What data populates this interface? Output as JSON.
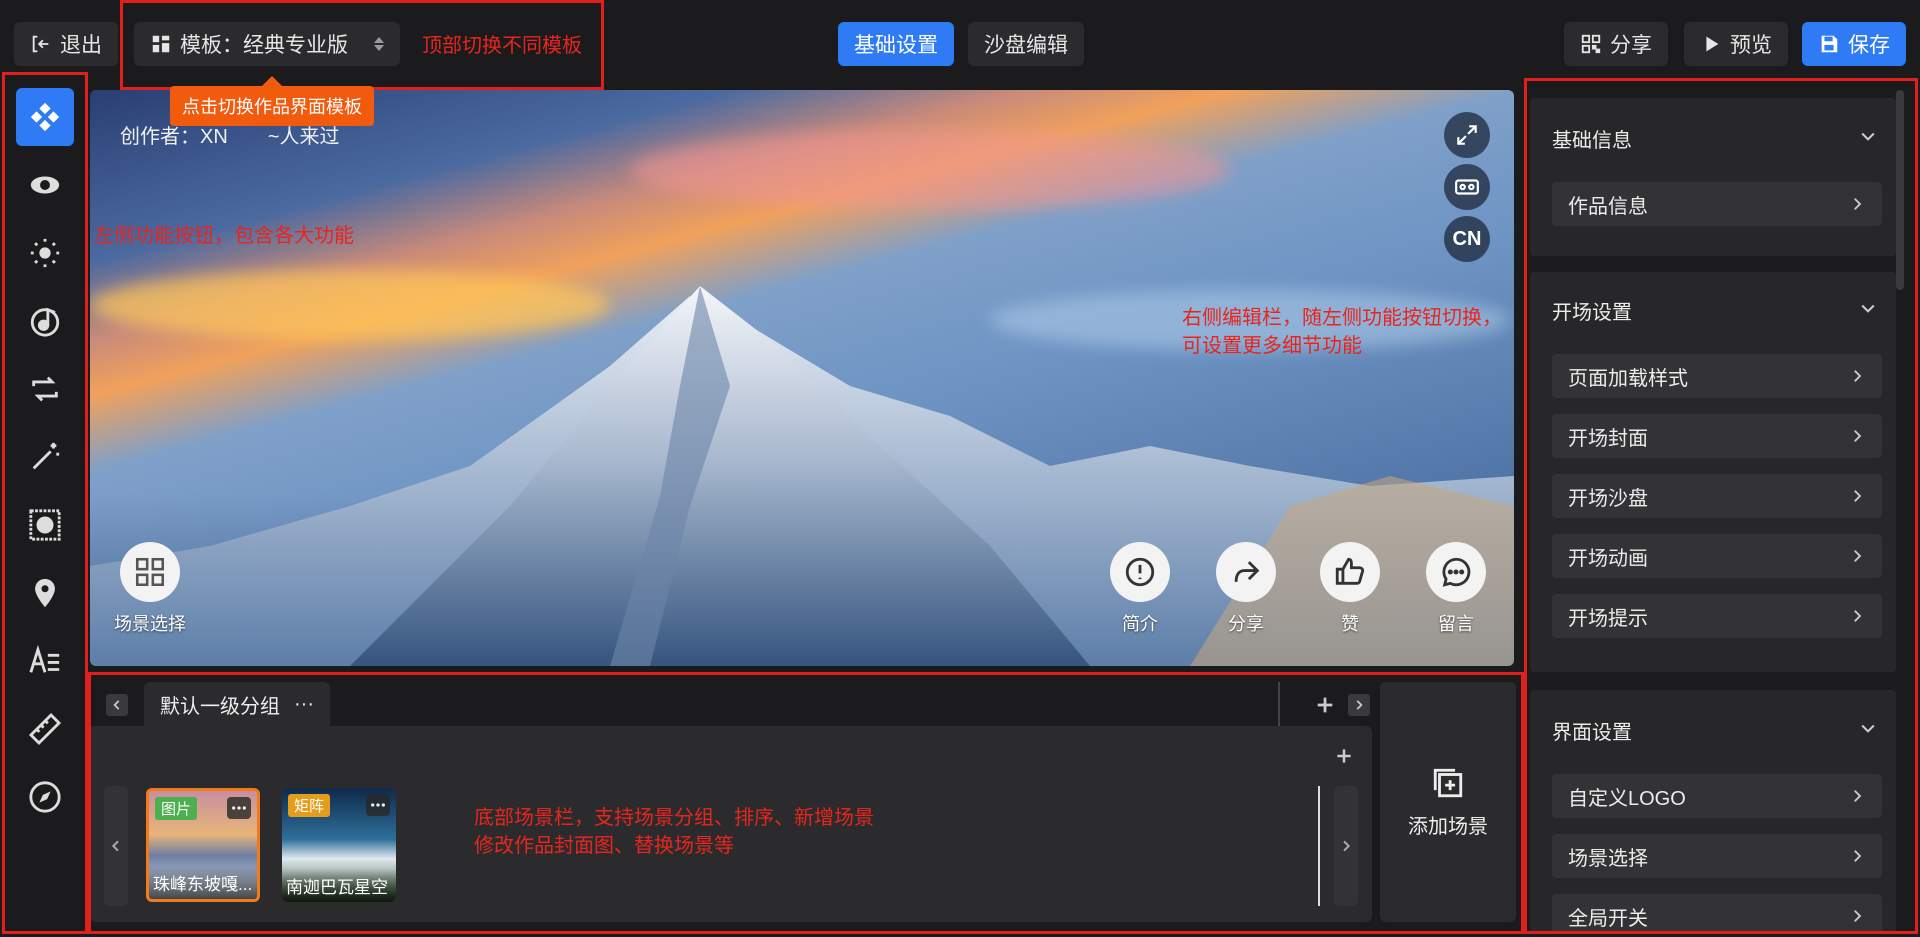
{
  "header": {
    "exit_label": "退出",
    "template_label": "模板：经典专业版",
    "tabs": [
      {
        "label": "基础设置",
        "active": true
      },
      {
        "label": "沙盘编辑",
        "active": false
      }
    ],
    "share_label": "分享",
    "preview_label": "预览",
    "save_label": "保存",
    "accent_color": "#2f7bf5"
  },
  "annotations": {
    "top": "顶部切换不同模板",
    "tooltip": "点击切换作品界面模板",
    "left": "左侧功能按钮，包含各大功能",
    "right_line1": "右侧编辑栏，随左侧功能按钮切换，",
    "right_line2": "可设置更多细节功能",
    "bottom_line1": "底部场景栏，支持场景分组、排序、新增场景",
    "bottom_line2": "修改作品封面图、替换场景等",
    "color": "#e0201c"
  },
  "sidebar": {
    "items": [
      {
        "icon": "layers-icon",
        "active": true
      },
      {
        "icon": "eye-icon"
      },
      {
        "icon": "sun-icon"
      },
      {
        "icon": "music-icon"
      },
      {
        "icon": "switch-icon"
      },
      {
        "icon": "magic-wand-icon"
      },
      {
        "icon": "image-frame-icon"
      },
      {
        "icon": "location-pin-icon"
      },
      {
        "icon": "text-icon"
      },
      {
        "icon": "ruler-icon"
      },
      {
        "icon": "compass-icon"
      }
    ]
  },
  "preview": {
    "creator": "创作者：XN　　~人来过",
    "lang_label": "CN",
    "scene_select_label": "场景选择",
    "actions": [
      {
        "label": "简介",
        "icon": "info-icon"
      },
      {
        "label": "分享",
        "icon": "share-icon"
      },
      {
        "label": "赞",
        "icon": "thumbs-up-icon"
      },
      {
        "label": "留言",
        "icon": "comment-icon"
      }
    ]
  },
  "right_panel": {
    "sections": [
      {
        "title": "基础信息",
        "items": [
          "作品信息"
        ]
      },
      {
        "title": "开场设置",
        "items": [
          "页面加载样式",
          "开场封面",
          "开场沙盘",
          "开场动画",
          "开场提示"
        ]
      },
      {
        "title": "界面设置",
        "items": [
          "自定义LOGO",
          "场景选择",
          "全局开关"
        ]
      }
    ]
  },
  "scene_bar": {
    "group_label": "默认一级分组",
    "group_more": "···",
    "scenes": [
      {
        "tag": "图片",
        "name": "珠峰东坡嘎...",
        "selected": true
      },
      {
        "tag": "矩阵",
        "name": "南迦巴瓦星空",
        "selected": false
      }
    ],
    "add_scene_label": "添加场景"
  }
}
